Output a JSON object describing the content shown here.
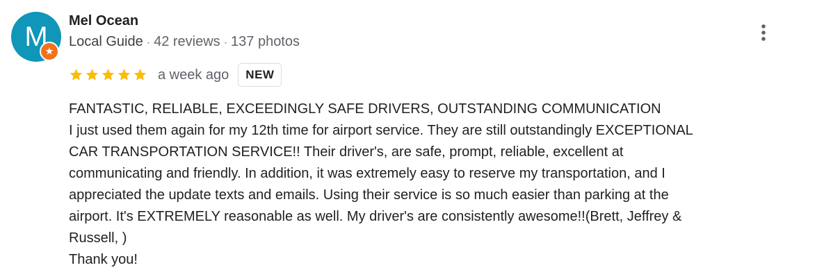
{
  "reviewer": {
    "initial": "M",
    "name": "Mel Ocean",
    "role": "Local Guide",
    "reviews": "42 reviews",
    "photos": "137 photos",
    "badge_icon": "local-guide-star-icon",
    "avatar_color": "#0f96b8",
    "badge_color": "#f2711c"
  },
  "rating": {
    "stars": 5,
    "max_stars": 5,
    "star_color": "#fbbc04",
    "time": "a week ago",
    "new_label": "NEW"
  },
  "review": {
    "lines": [
      "FANTASTIC, RELIABLE, EXCEEDINGLY SAFE DRIVERS, OUTSTANDING COMMUNICATION",
      "I just used them again for my 12th time for airport service. They are still outstandingly EXCEPTIONAL",
      "CAR TRANSPORTATION SERVICE!! Their driver's, are safe, prompt, reliable, excellent at",
      "communicating and friendly. In addition, it was extremely easy to reserve my transportation, and I",
      "appreciated the update texts and emails. Using their service is so much easier than parking at the",
      "airport. It's EXTREMELY reasonable as well. My driver's are consistently awesome!!(Brett, Jeffrey &",
      "Russell, )",
      "Thank you!"
    ]
  },
  "actions": {
    "more_icon": "more-vert-icon"
  }
}
